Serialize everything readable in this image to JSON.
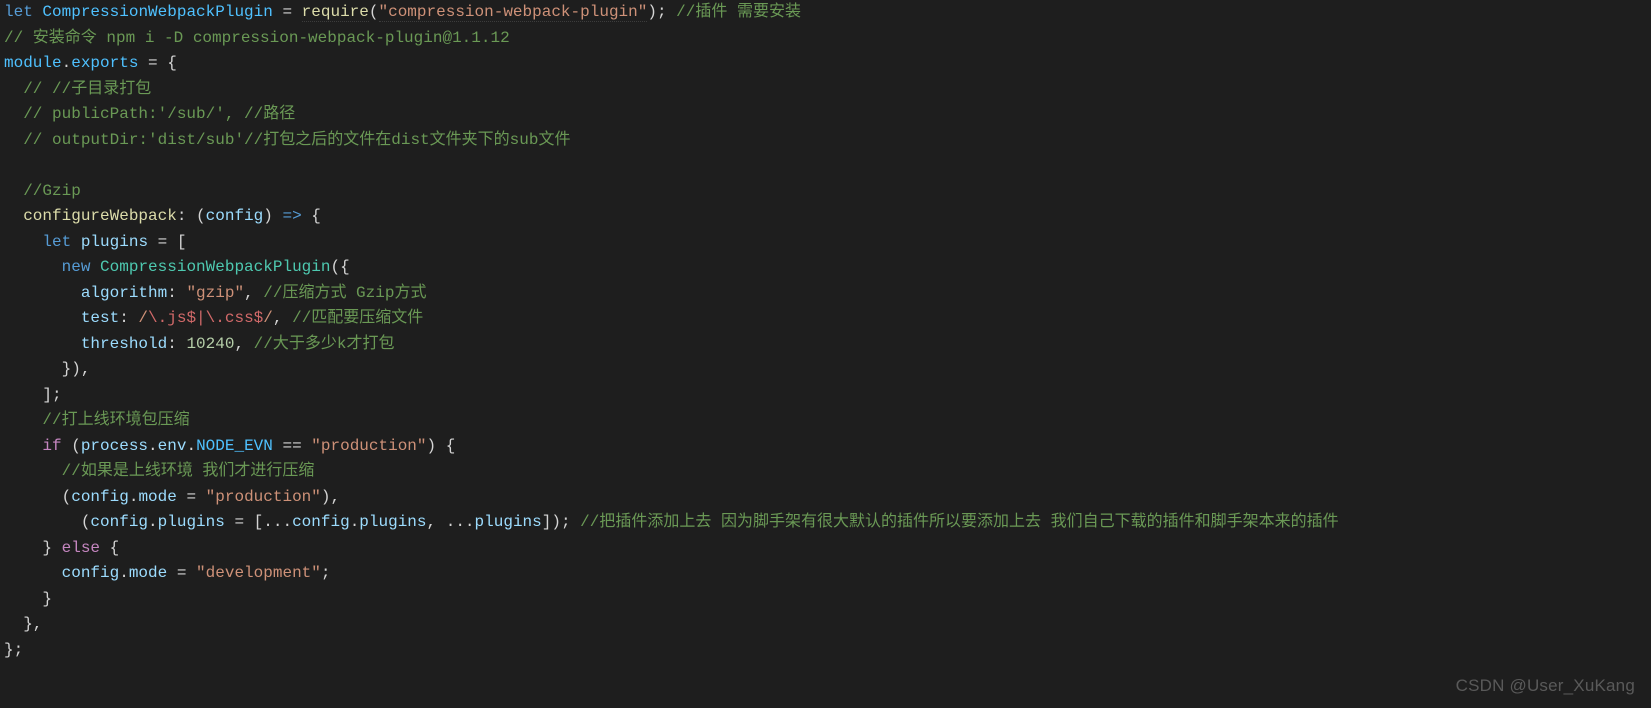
{
  "code": {
    "l1": {
      "let": "let",
      "varName": "CompressionWebpackPlugin",
      "eq": " = ",
      "require": "require",
      "openParen": "(",
      "pkg": "\"compression-webpack-plugin\"",
      "closeParen": ")",
      "semi": "; ",
      "comment": "//插件 需要安装"
    },
    "l2": {
      "comment": "// 安装命令 npm i -D compression-webpack-plugin@1.1.12"
    },
    "l3": {
      "module": "module",
      "dot": ".",
      "exports": "exports",
      "rest": " = {"
    },
    "l4": {
      "comment": "  // //子目录打包"
    },
    "l5": {
      "comment": "  // publicPath:'/sub/', //路径"
    },
    "l6": {
      "comment": "  // outputDir:'dist/sub'//打包之后的文件在dist文件夹下的sub文件"
    },
    "l7": {
      "blank": ""
    },
    "l8": {
      "comment": "  //Gzip"
    },
    "l9": {
      "indent": "  ",
      "prop": "configureWebpack",
      "colon": ": ",
      "openParen": "(",
      "param": "config",
      "closeParen": ")",
      "arrow": " => ",
      "brace": "{"
    },
    "l10": {
      "indent": "    ",
      "let": "let",
      "sp": " ",
      "var": "plugins",
      "rest": " = ["
    },
    "l11": {
      "indent": "      ",
      "new": "new",
      "sp": " ",
      "class": "CompressionWebpackPlugin",
      "rest": "({"
    },
    "l12": {
      "indent": "        ",
      "prop": "algorithm",
      "colon": ": ",
      "val": "\"gzip\"",
      "comma": ", ",
      "comment": "//压缩方式 Gzip方式"
    },
    "l13": {
      "indent": "        ",
      "prop": "test",
      "colon": ": ",
      "regexOpen": "/",
      "regexBody1": "\\.",
      "regexBody2": "js",
      "regexDollar1": "$",
      "regexPipe": "|",
      "regexBody3": "\\.",
      "regexBody4": "css",
      "regexDollar2": "$",
      "regexClose": "/",
      "comma": ", ",
      "comment": "//匹配要压缩文件"
    },
    "l14": {
      "indent": "        ",
      "prop": "threshold",
      "colon": ": ",
      "val": "10240",
      "comma": ", ",
      "comment": "//大于多少k才打包"
    },
    "l15": {
      "text": "      }),"
    },
    "l16": {
      "text": "    ];"
    },
    "l17": {
      "indent": "    ",
      "comment": "//打上线环境包压缩"
    },
    "l18": {
      "indent": "    ",
      "if": "if",
      "sp": " (",
      "obj1": "process",
      "dot1": ".",
      "obj2": "env",
      "dot2": ".",
      "obj3": "NODE_EVN",
      "op": " == ",
      "str": "\"production\"",
      "rest": ") {"
    },
    "l19": {
      "indent": "      ",
      "comment": "//如果是上线环境 我们才进行压缩"
    },
    "l20": {
      "indent": "      (",
      "obj": "config",
      "dot": ".",
      "prop": "mode",
      "eq": " = ",
      "val": "\"production\"",
      "rest": "),"
    },
    "l21": {
      "indent": "        (",
      "obj1": "config",
      "dot1": ".",
      "prop1": "plugins",
      "eq": " = [...",
      "obj2": "config",
      "dot2": ".",
      "prop2": "plugins",
      "comma": ", ...",
      "var": "plugins",
      "rest": "]); ",
      "comment": "//把插件添加上去 因为脚手架有很大默认的插件所以要添加上去 我们自己下载的插件和脚手架本来的插件"
    },
    "l22": {
      "indent": "    } ",
      "else": "else",
      "rest": " {"
    },
    "l23": {
      "indent": "      ",
      "obj": "config",
      "dot": ".",
      "prop": "mode",
      "eq": " = ",
      "val": "\"development\"",
      "semi": ";"
    },
    "l24": {
      "text": "    }"
    },
    "l25": {
      "text": "  },"
    },
    "l26": {
      "text": "};"
    }
  },
  "watermark": "CSDN @User_XuKang"
}
